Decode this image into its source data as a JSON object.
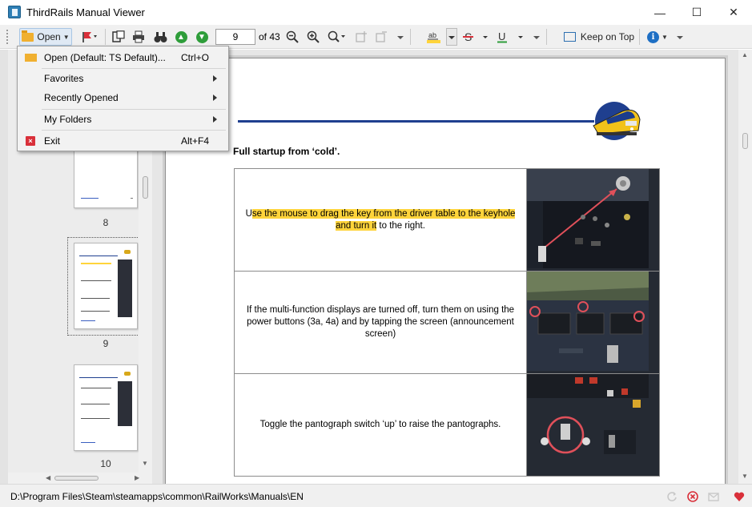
{
  "window": {
    "title": "ThirdRails Manual Viewer",
    "controls": {
      "minimize": "—",
      "maximize": "☐",
      "close": "✕"
    }
  },
  "toolbar": {
    "open_label": "Open",
    "page_value": "9",
    "page_total": "of 43",
    "keep_on_top_label": "Keep on Top",
    "icons": [
      "open-folder-icon",
      "bookmark-flag-icon",
      "thumbnails-icon",
      "print-icon",
      "find-binoculars-icon",
      "previous-page-icon",
      "next-page-icon",
      "zoom-out-icon",
      "zoom-in-icon",
      "zoom-menu-icon",
      "add-bookmark-icon",
      "remove-bookmark-icon",
      "highlight-icon",
      "strikethrough-icon",
      "underline-icon",
      "keep-on-top-icon",
      "info-icon"
    ]
  },
  "open_menu": {
    "items": [
      {
        "label": "Open (Default: TS Default)...",
        "shortcut": "Ctrl+O",
        "icon": "open-folder-icon",
        "submenu": false
      },
      {
        "label": "Favorites",
        "shortcut": "",
        "submenu": true
      },
      {
        "label": "Recently Opened",
        "shortcut": "",
        "submenu": true
      },
      {
        "label": "My Folders",
        "shortcut": "",
        "submenu": true
      },
      {
        "label": "Exit",
        "shortcut": "Alt+F4",
        "icon": "exit-icon",
        "submenu": false
      }
    ]
  },
  "thumbnails": {
    "pages": [
      {
        "number": "8",
        "selected": false
      },
      {
        "number": "9",
        "selected": true
      },
      {
        "number": "10",
        "selected": false
      }
    ]
  },
  "document": {
    "section_heading": "Full startup from ‘cold’.",
    "steps": [
      {
        "text_before": "U",
        "text_highlighted": "se the mouse to drag the key from the driver table to the keyhole and turn it",
        "text_after": " to the right.",
        "image": "cab-key-image"
      },
      {
        "text": "If the multi-function displays are turned off, turn them on using the power buttons (3a, 4a) and by tapping the screen (announcement screen)",
        "image": "cab-displays-image"
      },
      {
        "text": "Toggle the pantograph switch ‘up’ to raise the pantographs.",
        "image": "pantograph-switch-image"
      }
    ]
  },
  "status": {
    "path": "D:\\Program Files\\Steam\\steamapps\\common\\RailWorks\\Manuals\\EN"
  },
  "colors": {
    "accent": "#1e6fc4",
    "highlight": "#ffd43b",
    "rule": "#1f3f8f",
    "exit_icon": "#d9303a",
    "status_heart": "#d9303a"
  }
}
